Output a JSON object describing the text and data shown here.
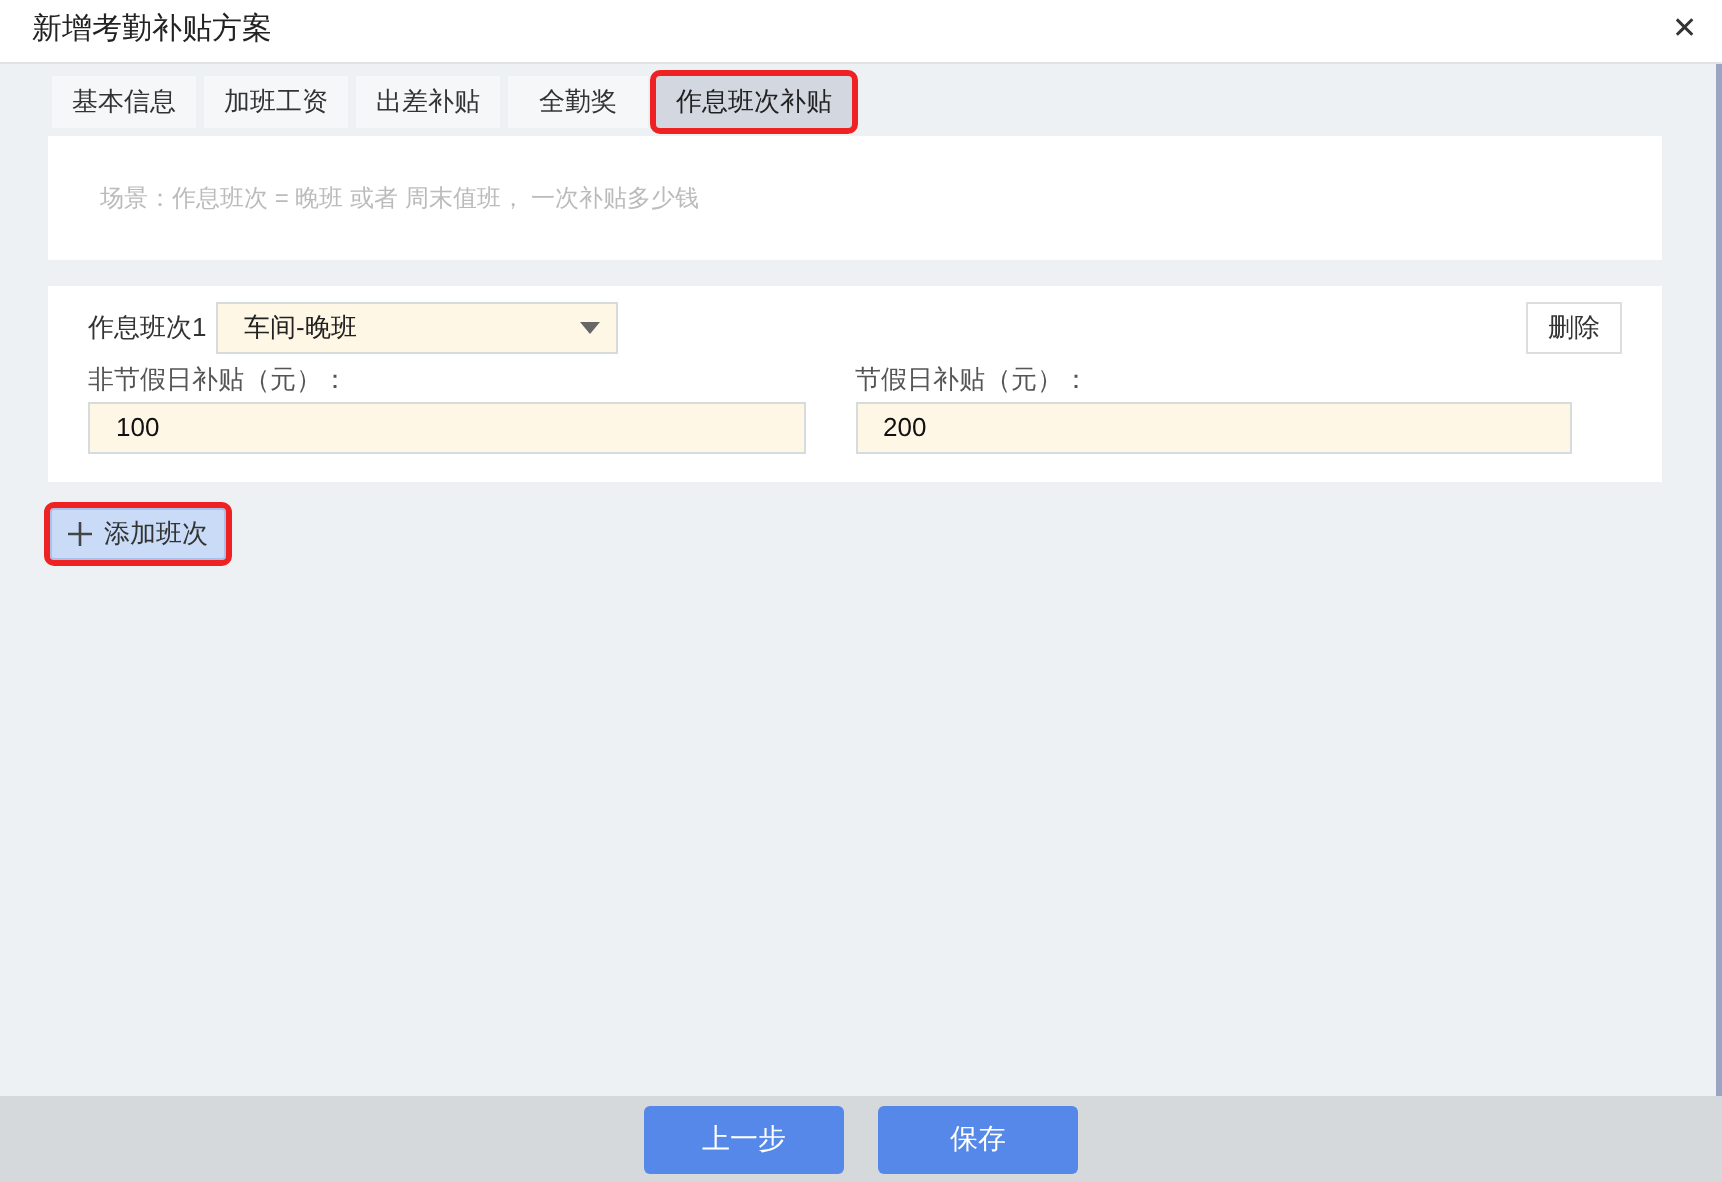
{
  "window": {
    "title": "新增考勤补贴方案",
    "close": "✕"
  },
  "tabs": [
    {
      "label": "基本信息",
      "selected": false,
      "highlighted": false
    },
    {
      "label": "加班工资",
      "selected": false,
      "highlighted": false
    },
    {
      "label": "出差补贴",
      "selected": false,
      "highlighted": false
    },
    {
      "label": "全勤奖",
      "selected": false,
      "highlighted": false
    },
    {
      "label": "作息班次补贴",
      "selected": true,
      "highlighted": true
    }
  ],
  "scene_note": "场景：作息班次 = 晚班 或者 周末值班， 一次补贴多少钱",
  "shifts": [
    {
      "label": "作息班次1",
      "shift": "车间-晚班",
      "delete": "删除",
      "fields": [
        {
          "label": "非节假日补贴（元）：",
          "value": "100"
        },
        {
          "label": "节假日补贴（元）：",
          "value": "200"
        }
      ]
    }
  ],
  "add_button": {
    "label": "添加班次",
    "highlighted": true
  },
  "footer_buttons": [
    "上一步",
    "保存"
  ]
}
